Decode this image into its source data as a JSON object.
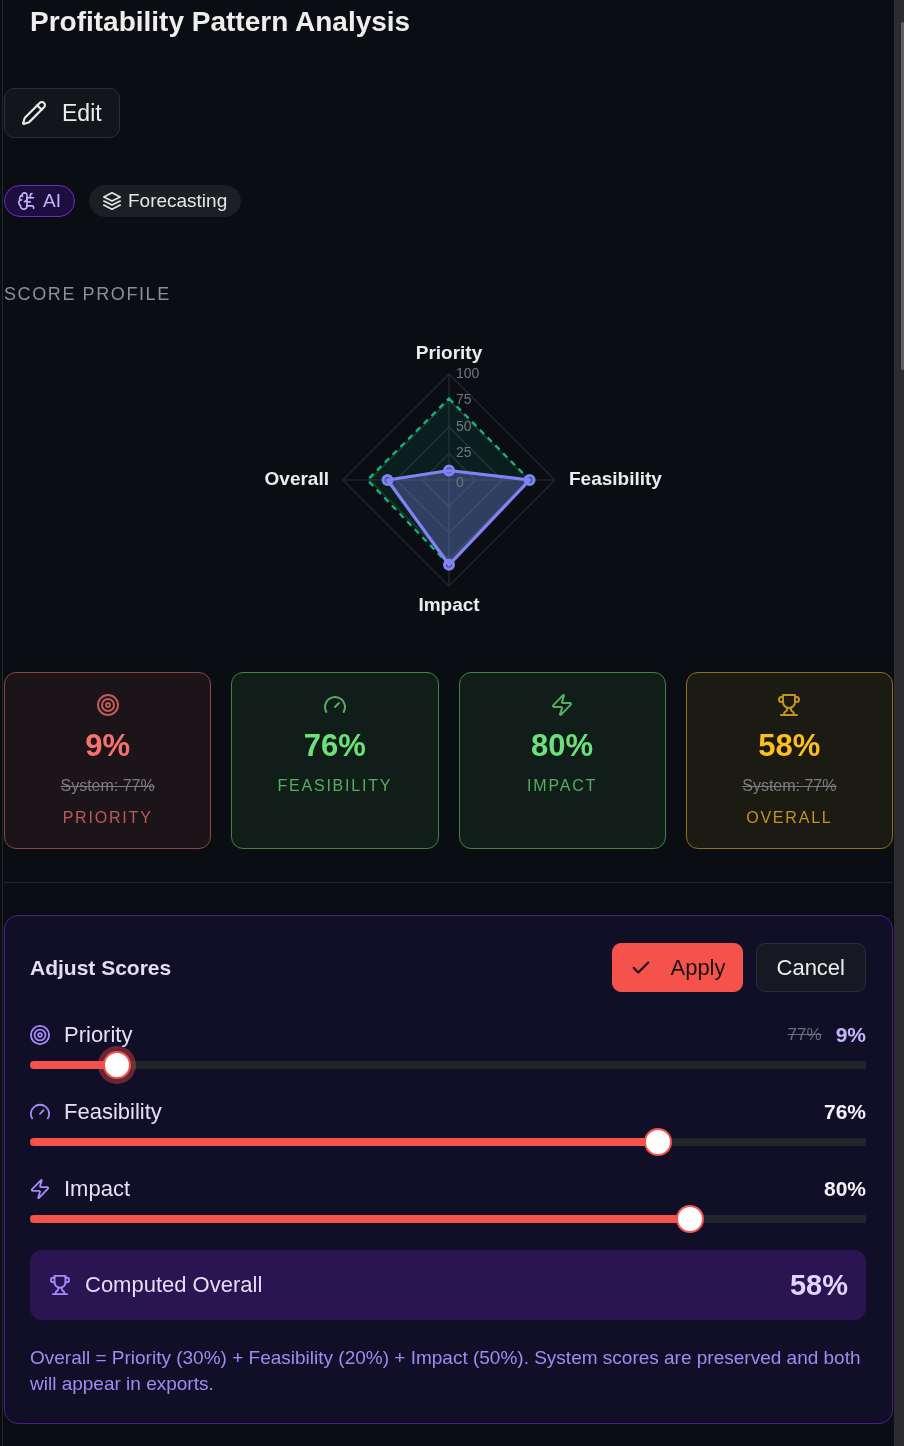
{
  "header": {
    "title": "Profitability Pattern Analysis",
    "edit_button": "Edit"
  },
  "tags": [
    {
      "label": "AI",
      "kind": "accent"
    },
    {
      "label": "Forecasting",
      "kind": "neutral"
    }
  ],
  "score_profile": {
    "heading": "SCORE PROFILE",
    "chart_data": {
      "type": "radar",
      "categories": [
        "Priority",
        "Feasibility",
        "Impact",
        "Overall"
      ],
      "series": [
        {
          "color": "#10b981",
          "values": [
            77,
            76,
            80,
            77
          ]
        },
        {
          "color": "#8183f4",
          "values": [
            9,
            76,
            80,
            58
          ]
        }
      ],
      "ylim": [
        0,
        100
      ],
      "yticks": [
        0,
        25,
        50,
        75,
        100
      ]
    }
  },
  "cards": [
    {
      "value": "9%",
      "system": "System: 77%",
      "label": "PRIORITY",
      "color": "#f87171"
    },
    {
      "value": "76%",
      "label": "FEASIBILITY",
      "color": "#6ee07a"
    },
    {
      "value": "80%",
      "label": "IMPACT",
      "color": "#6ee07a"
    },
    {
      "value": "58%",
      "system": "System: 77%",
      "label": "OVERALL",
      "color": "#fbbf24"
    }
  ],
  "adjust_panel": {
    "title": "Adjust Scores",
    "buttons": [
      {
        "label": "Apply",
        "kind": "primary"
      },
      {
        "label": "Cancel",
        "kind": "secondary"
      }
    ],
    "sliders": [
      {
        "label": "Priority",
        "original": "77%",
        "value": "9%",
        "level": 0.09,
        "focused": true
      },
      {
        "label": "Feasibility",
        "value": "76%",
        "level": 0.76,
        "focused": false
      },
      {
        "label": "Impact",
        "value": "80%",
        "level": 0.8,
        "focused": false
      }
    ],
    "computed": {
      "label": "Computed Overall",
      "value": "58%"
    },
    "note": "Overall = Priority (30%) + Feasibility (20%) + Impact (50%). System scores are preserved and both will appear in exports."
  }
}
